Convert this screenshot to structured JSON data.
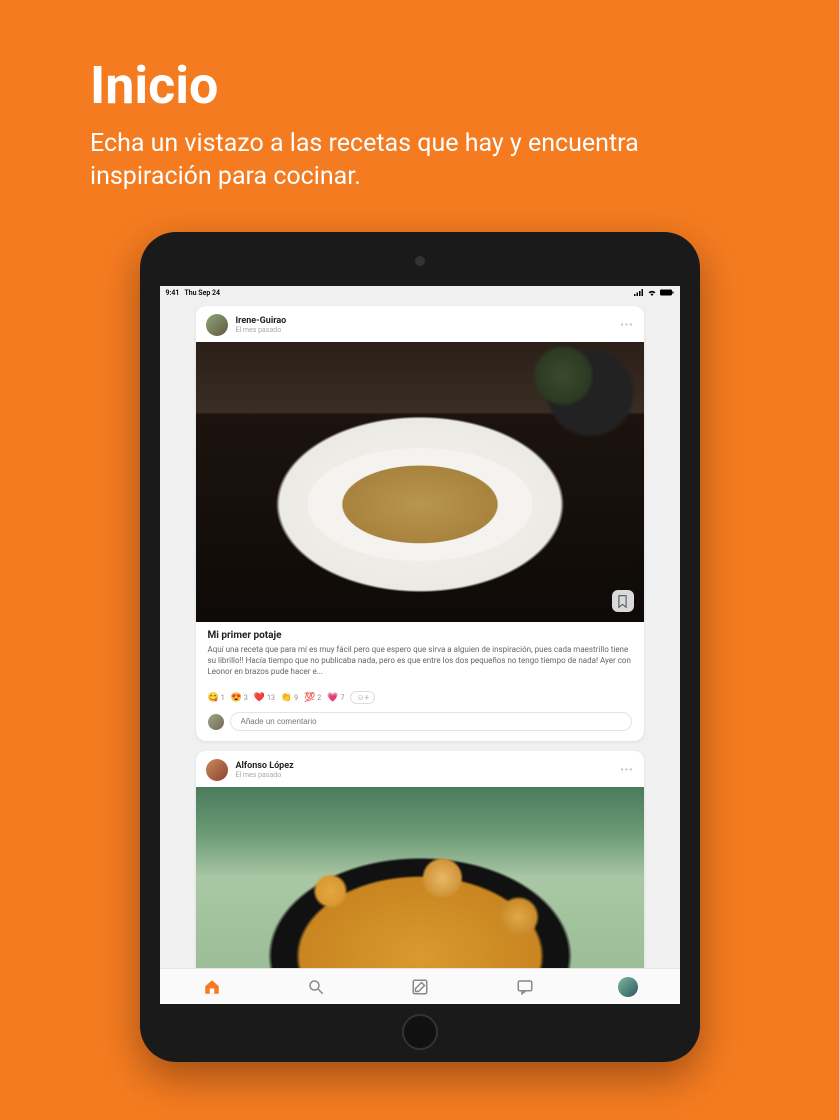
{
  "promo": {
    "title": "Inicio",
    "subtitle": "Echa un vistazo a las recetas que hay y encuentra inspiración para cocinar."
  },
  "status_bar": {
    "time": "9:41",
    "date": "Thu Sep 24"
  },
  "posts": [
    {
      "author": "Irene-Guirao",
      "timestamp": "El mes pasado",
      "title": "Mi primer potaje",
      "description": "Aquí una receta que para mí es muy fácil pero que espero que sirva a alguien de inspiración, pues cada maestrillo tiene su librillo!! Hacía tiempo que no publicaba nada, pero es que entre los dos pequeños no tengo tiempo de nada! Ayer con Leonor en brazos pude hacer e...",
      "reactions": [
        {
          "emoji": "😋",
          "count": "1"
        },
        {
          "emoji": "😍",
          "count": "3"
        },
        {
          "emoji": "❤️",
          "count": "13"
        },
        {
          "emoji": "👏",
          "count": "9"
        },
        {
          "emoji": "💯",
          "count": "2"
        },
        {
          "emoji": "💗",
          "count": "7"
        }
      ],
      "comment_placeholder": "Añade un comentario"
    },
    {
      "author": "Alfonso López",
      "timestamp": "El mes pasado"
    }
  ]
}
